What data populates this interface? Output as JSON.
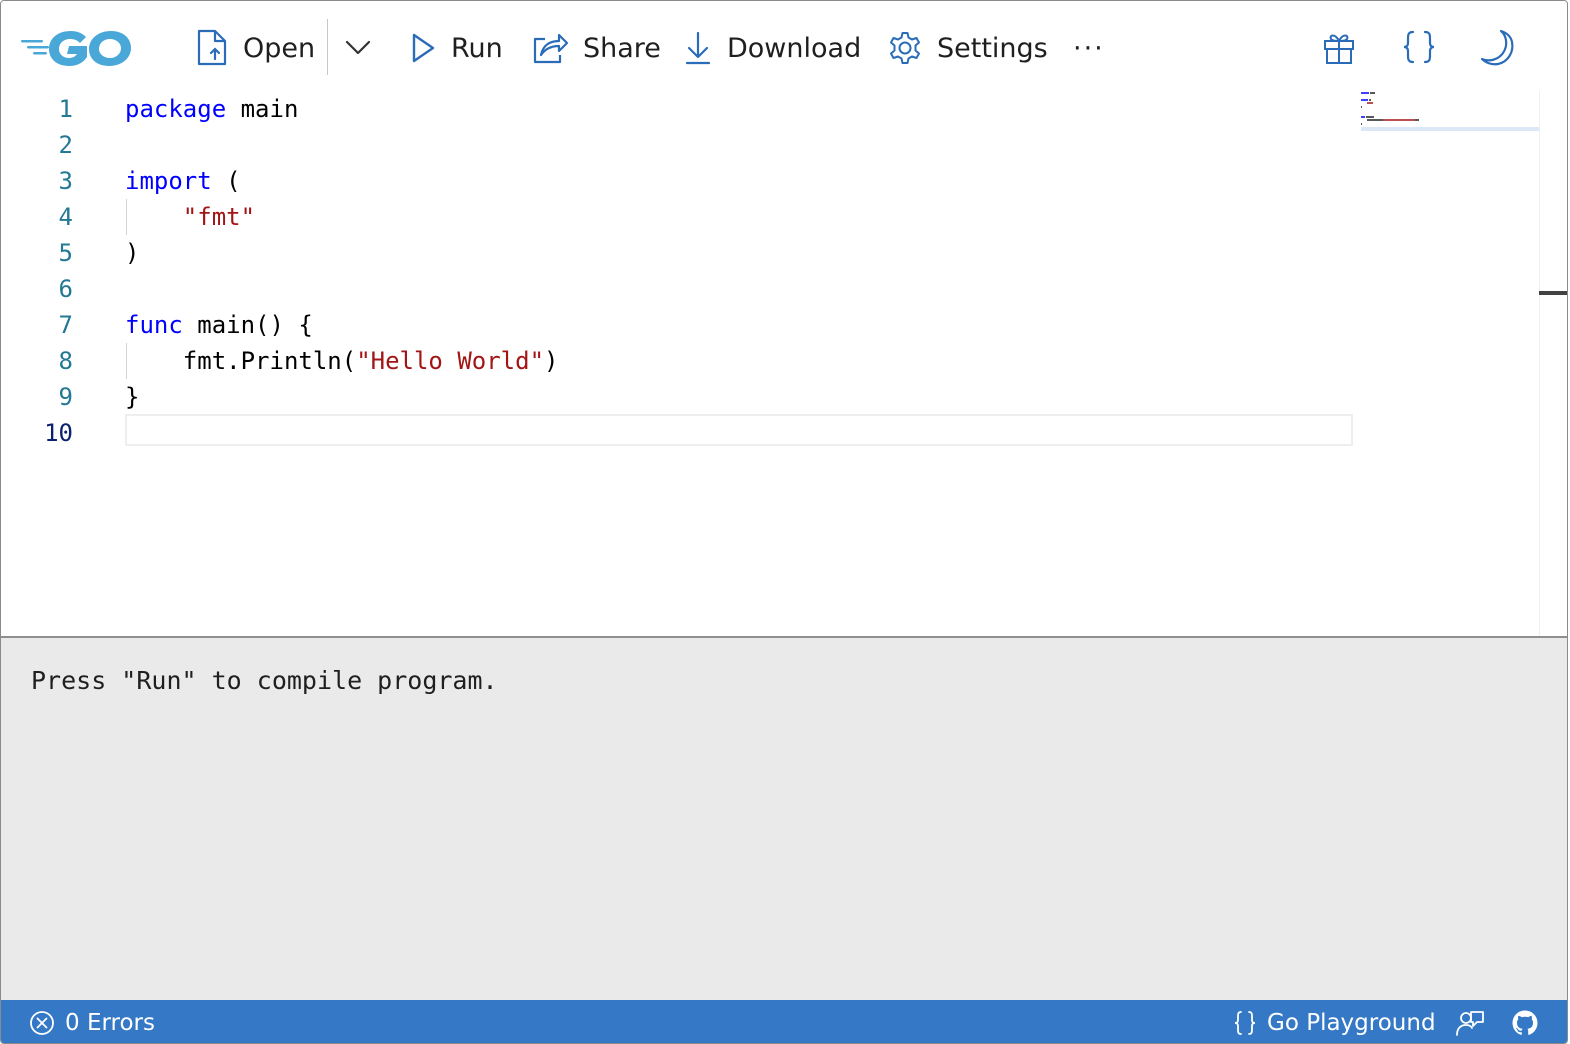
{
  "toolbar": {
    "logo_text": "GO",
    "open_label": "Open",
    "run_label": "Run",
    "share_label": "Share",
    "download_label": "Download",
    "settings_label": "Settings",
    "more_label": "···",
    "icons": [
      "file-open-icon",
      "chevron-down-icon",
      "play-icon",
      "share-icon",
      "download-icon",
      "gear-icon",
      "gift-icon",
      "braces-icon",
      "moon-icon"
    ]
  },
  "editor": {
    "line_numbers": [
      "1",
      "2",
      "3",
      "4",
      "5",
      "6",
      "7",
      "8",
      "9",
      "10"
    ],
    "lines": [
      [
        {
          "t": "package",
          "c": "kw"
        },
        {
          "t": " main",
          "c": ""
        }
      ],
      [],
      [
        {
          "t": "import",
          "c": "kw"
        },
        {
          "t": " (",
          "c": ""
        }
      ],
      [
        {
          "t": "    ",
          "c": ""
        },
        {
          "t": "\"fmt\"",
          "c": "str"
        }
      ],
      [
        {
          "t": ")",
          "c": ""
        }
      ],
      [],
      [
        {
          "t": "func",
          "c": "kw"
        },
        {
          "t": " main() {",
          "c": ""
        }
      ],
      [
        {
          "t": "    fmt.Println(",
          "c": ""
        },
        {
          "t": "\"Hello World\"",
          "c": "str"
        },
        {
          "t": ")",
          "c": ""
        }
      ],
      [
        {
          "t": "}",
          "c": ""
        }
      ],
      []
    ],
    "active_line": "10"
  },
  "output": {
    "message": "Press \"Run\" to compile program."
  },
  "statusbar": {
    "errors_label": "0 Errors",
    "brand_label": "Go Playground"
  },
  "colors": {
    "accent": "#3478c6",
    "keyword": "#0000ff",
    "string": "#a31515",
    "line_number": "#237893",
    "output_bg": "#ebeaea",
    "gopher_blue": "#00add8"
  }
}
